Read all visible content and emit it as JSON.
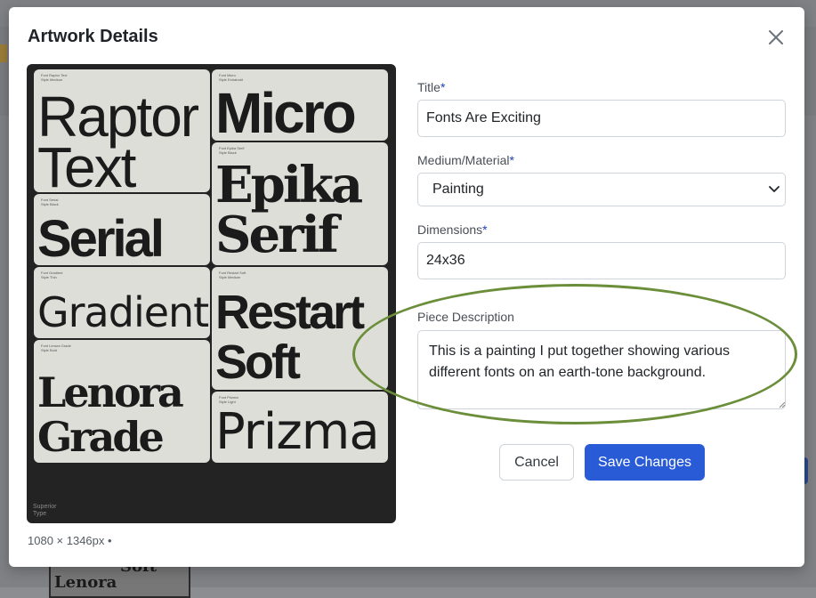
{
  "modal": {
    "title": "Artwork Details",
    "close_icon": "close-icon"
  },
  "artwork": {
    "cards": [
      {
        "meta": "Font Raptor Text\nStyle Medium",
        "lines": [
          "Raptor",
          "Text"
        ]
      },
      {
        "meta": "Font Micro\nStyle Extrabold",
        "lines": [
          "Micro"
        ]
      },
      {
        "meta": "Font Epika Serif\nStyle Black",
        "lines": [
          "Epika",
          "Serif"
        ]
      },
      {
        "meta": "Font Serial\nStyle Black",
        "lines": [
          "Serial"
        ]
      },
      {
        "meta": "Font Gradient\nStyle Thin",
        "lines": [
          "Gradient"
        ]
      },
      {
        "meta": "Font Restart Soft\nStyle Medium",
        "lines": [
          "Restart",
          "Soft"
        ]
      },
      {
        "meta": "Font Lenora Grade\nStyle Bold",
        "lines": [
          "Lenora",
          "Grade"
        ]
      },
      {
        "meta": "Font Prizma\nStyle Light",
        "lines": [
          "Prizma"
        ]
      }
    ],
    "footer_line1": "Superior",
    "footer_line2": "Type",
    "dimensions_caption": "1080 × 1346px •"
  },
  "form": {
    "title": {
      "label": "Title",
      "required_mark": "*",
      "value": "Fonts Are Exciting"
    },
    "medium": {
      "label": "Medium/Material",
      "required_mark": "*",
      "selected": "Painting"
    },
    "dimensions": {
      "label": "Dimensions",
      "required_mark": "*",
      "value": "24x36"
    },
    "description": {
      "label": "Piece Description",
      "value": "This is a painting I put together showing various different fonts on an earth-tone background."
    },
    "cancel_label": "Cancel",
    "save_label": "Save Changes"
  },
  "background_page": {
    "thumb_line1": "Soft",
    "thumb_line2": "Lenora"
  },
  "colors": {
    "primary": "#2a5bd7",
    "required": "#1d3fb5",
    "highlight_ring": "#6b8e3a",
    "art_background": "#232323",
    "card_background": "#deded9"
  }
}
